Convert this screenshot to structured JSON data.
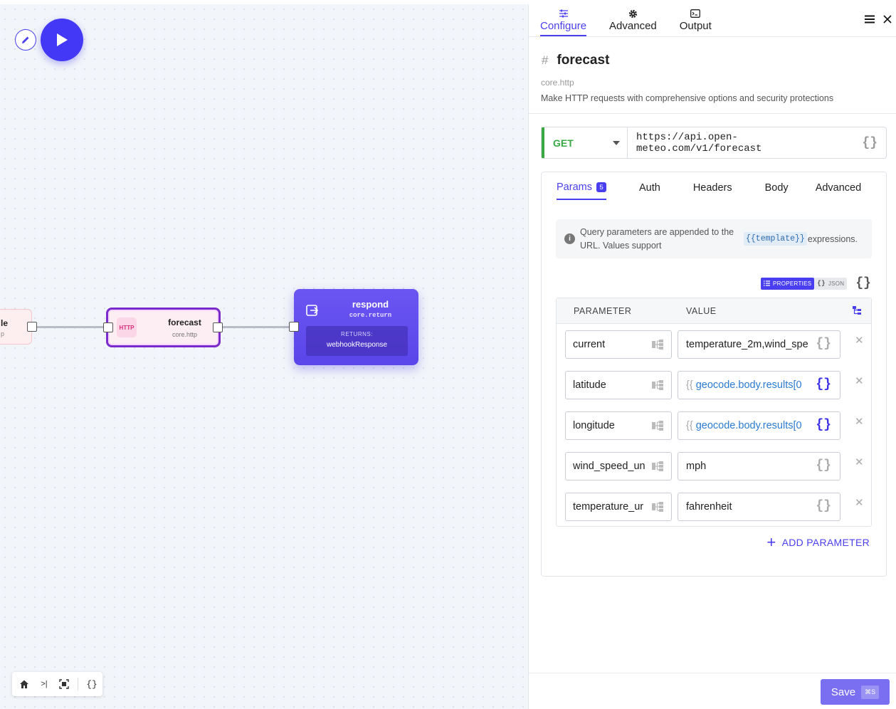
{
  "canvas": {
    "prev_node": {
      "title": "le",
      "subtitle": "p"
    },
    "forecast_node": {
      "badge": "HTTP",
      "title": "forecast",
      "subtitle": "core.http"
    },
    "respond_node": {
      "title": "respond",
      "subtitle": "core.return",
      "returns_label": "RETURNS:",
      "returns_value": "webhookResponse"
    },
    "toolbar": {
      "collapse_glyph": ">|",
      "braces_glyph": "{}"
    }
  },
  "panel": {
    "tabs": [
      {
        "label": "Configure"
      },
      {
        "label": "Advanced"
      },
      {
        "label": "Output"
      }
    ],
    "title": "forecast",
    "subtype": "core.http",
    "description": "Make HTTP requests with comprehensive options and security protections",
    "request": {
      "method": "GET",
      "url": "https://api.open-meteo.com/v1/forecast"
    },
    "req_tabs": [
      {
        "label": "Params",
        "count": "5"
      },
      {
        "label": "Auth"
      },
      {
        "label": "Headers"
      },
      {
        "label": "Body"
      },
      {
        "label": "Advanced"
      }
    ],
    "info": {
      "text": "Query parameters are appended to the URL. Values support",
      "code": "{{template}}",
      "after": "expressions."
    },
    "modes": {
      "properties": "PROPERTIES",
      "json": "JSON"
    },
    "table": {
      "col_param": "PARAMETER",
      "col_value": "VALUE",
      "rows": [
        {
          "name": "current",
          "value": "temperature_2m,wind_spe",
          "template": false
        },
        {
          "name": "latitude",
          "value_open": "{{",
          "value": "geocode.body.results[0",
          "template": true
        },
        {
          "name": "longitude",
          "value_open": "{{",
          "value": "geocode.body.results[0",
          "template": true
        },
        {
          "name": "wind_speed_un",
          "value": "mph",
          "template": false
        },
        {
          "name": "temperature_ur",
          "value": "fahrenheit",
          "template": false
        }
      ]
    },
    "add_parameter": "ADD PARAMETER",
    "save": {
      "label": "Save",
      "shortcut": "⌘S"
    }
  }
}
